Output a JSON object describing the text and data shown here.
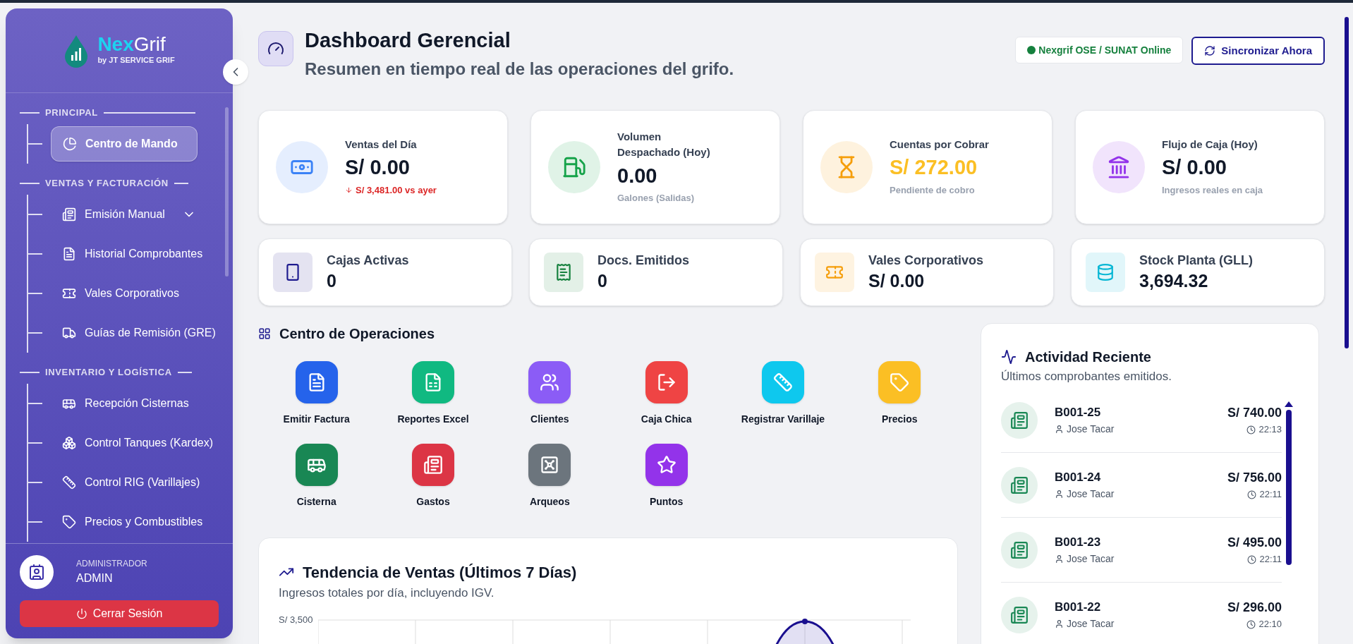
{
  "brand": {
    "name_part1": "Nex",
    "name_part2": "Grif",
    "tagline": "by JT SERVICE GRIF"
  },
  "sidebar": {
    "sections": [
      {
        "title": "PRINCIPAL",
        "items": [
          {
            "label": "Centro de Mando",
            "selected": true,
            "has_submenu": false
          }
        ]
      },
      {
        "title": "VENTAS Y FACTURACIÓN",
        "items": [
          {
            "label": "Emisión Manual",
            "selected": false,
            "has_submenu": true
          },
          {
            "label": "Historial Comprobantes",
            "selected": false,
            "has_submenu": false
          },
          {
            "label": "Vales Corporativos",
            "selected": false,
            "has_submenu": false
          },
          {
            "label": "Guías de Remisión (GRE)",
            "selected": false,
            "has_submenu": false
          }
        ]
      },
      {
        "title": "INVENTARIO Y LOGÍSTICA",
        "items": [
          {
            "label": "Recepción Cisternas",
            "selected": false,
            "has_submenu": false
          },
          {
            "label": "Control Tanques (Kardex)",
            "selected": false,
            "has_submenu": false
          },
          {
            "label": "Control RIG (Varillajes)",
            "selected": false,
            "has_submenu": false
          },
          {
            "label": "Precios y Combustibles",
            "selected": false,
            "has_submenu": false
          }
        ]
      }
    ]
  },
  "user": {
    "role": "ADMINISTRADOR",
    "name": "ADMIN"
  },
  "logout_button": "Cerrar Sesión",
  "header": {
    "title": "Dashboard Gerencial",
    "subtitle": "Resumen en tiempo real de las operaciones del grifo.",
    "status": {
      "label": "Nexgrif OSE / SUNAT Online",
      "online": true
    },
    "sync_button": "Sincronizar Ahora"
  },
  "kpis": [
    {
      "label": "Ventas del Día",
      "value": "S/ 0.00",
      "emphasis": false,
      "trend": {
        "down": true,
        "text": "S/ 3,481.00 vs ayer"
      },
      "color": "#3b82f6"
    },
    {
      "label": "Volumen Despachado (Hoy)",
      "value": "0.00",
      "emphasis": false,
      "note": "Galones (Salidas)",
      "color": "#16a34a"
    },
    {
      "label": "Cuentas por Cobrar",
      "value": "S/ 272.00",
      "emphasis": true,
      "note": "Pendiente de cobro",
      "color": "#f59e0b"
    },
    {
      "label": "Flujo de Caja (Hoy)",
      "value": "S/ 0.00",
      "emphasis": false,
      "note": "Ingresos reales en caja",
      "color": "#9333ea"
    }
  ],
  "mini_stats": [
    {
      "label": "Cajas Activas",
      "value": "0",
      "color": "#1e1b8f"
    },
    {
      "label": "Docs. Emitidos",
      "value": "0",
      "color": "#15803d"
    },
    {
      "label": "Vales Corporativos",
      "value": "S/ 0.00",
      "color": "#f59e0b"
    },
    {
      "label": "Stock Planta (GLL)",
      "value": "3,694.32",
      "color": "#06b6d4"
    }
  ],
  "operations": {
    "title": "Centro de Operaciones",
    "tiles": [
      {
        "label": "Emitir Factura",
        "color": "#2563eb"
      },
      {
        "label": "Reportes Excel",
        "color": "#10b981"
      },
      {
        "label": "Clientes",
        "color": "#8b5cf6"
      },
      {
        "label": "Caja Chica",
        "color": "#ef4444"
      },
      {
        "label": "Registrar Varillaje",
        "color": "#0ec8ee"
      },
      {
        "label": "Precios",
        "color": "#fbbf24"
      },
      {
        "label": "Cisterna",
        "color": "#198754"
      },
      {
        "label": "Gastos",
        "color": "#dc3545"
      },
      {
        "label": "Arqueos",
        "color": "#6c757d"
      },
      {
        "label": "Puntos",
        "color": "#9333ea"
      }
    ]
  },
  "sales_trend": {
    "title": "Tendencia de Ventas (Últimos 7 Días)",
    "subtitle": "Ingresos totales por día, incluyendo IGV.",
    "axis_label": "S/ 3,500"
  },
  "activity": {
    "title": "Actividad Reciente",
    "subtitle": "Últimos comprobantes emitidos.",
    "items": [
      {
        "doc": "B001-25",
        "user": "Jose Tacar",
        "amount": "S/ 740.00",
        "time": "22:13"
      },
      {
        "doc": "B001-24",
        "user": "Jose Tacar",
        "amount": "S/ 756.00",
        "time": "22:11"
      },
      {
        "doc": "B001-23",
        "user": "Jose Tacar",
        "amount": "S/ 495.00",
        "time": "22:11"
      },
      {
        "doc": "B001-22",
        "user": "Jose Tacar",
        "amount": "S/ 296.00",
        "time": "22:10"
      }
    ]
  }
}
